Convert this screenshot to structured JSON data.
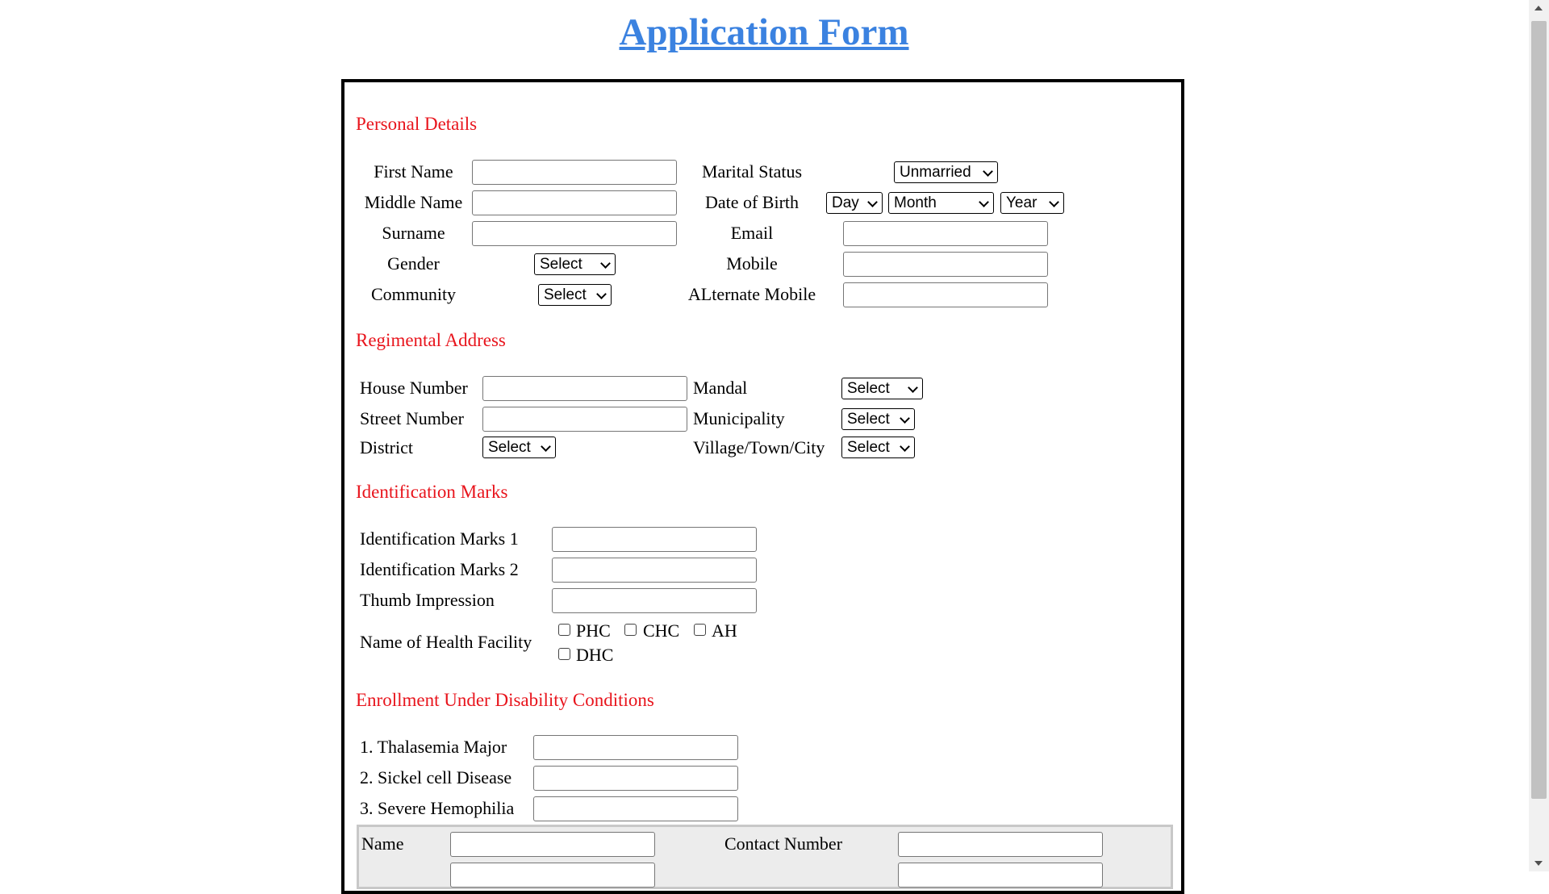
{
  "title": "Application Form",
  "sections": {
    "personal": "Personal Details",
    "address": "Regimental Address",
    "identification": "Identification Marks",
    "disability": "Enrollment Under Disability Conditions"
  },
  "personal": {
    "first_name": "First Name",
    "middle_name": "Middle Name",
    "surname": "Surname",
    "gender": "Gender",
    "gender_value": "Select",
    "community": "Community",
    "community_value": "Select",
    "marital_status": "Marital Status",
    "marital_value": "Unmarried",
    "dob": "Date of Birth",
    "dob_day": "Day",
    "dob_month": "Month",
    "dob_year": "Year",
    "email": "Email",
    "mobile": "Mobile",
    "alt_mobile": "ALternate Mobile"
  },
  "address": {
    "house_number": "House Number",
    "street_number": "Street Number",
    "district": "District",
    "district_value": "Select",
    "mandal": "Mandal",
    "mandal_value": "Select",
    "municipality": "Municipality",
    "municipality_value": "Select",
    "village": "Village/Town/City",
    "village_value": "Select"
  },
  "identification": {
    "mark1": "Identification Marks 1",
    "mark2": "Identification Marks 2",
    "thumb": "Thumb Impression",
    "health_facility": "Name of Health Facility",
    "facilities": [
      "PHC",
      "CHC",
      "AH",
      "DHC"
    ]
  },
  "disability": {
    "items": [
      "1. Thalasemia Major",
      "2. Sickel cell Disease",
      "3. Severe Hemophilia"
    ]
  },
  "guardian": {
    "name": "Name",
    "contact_number": "Contact Number"
  }
}
